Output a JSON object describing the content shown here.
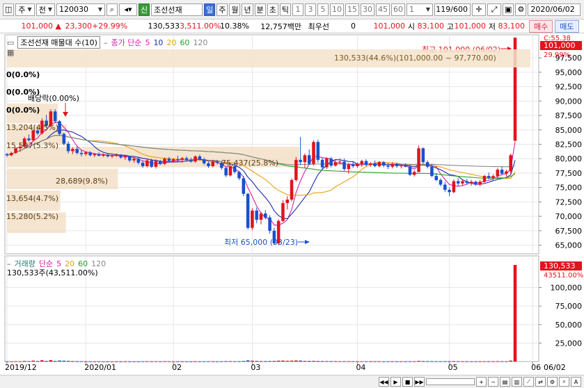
{
  "toolbar": {
    "type_label": "주",
    "period_label": "전",
    "code": "120030",
    "stock_name": "조선선재",
    "new_badge": "신",
    "periods": [
      "일",
      "주",
      "월",
      "년",
      "분",
      "초",
      "틱"
    ],
    "active_period": "일",
    "minute_steps": [
      "1",
      "3",
      "5",
      "10",
      "15",
      "30",
      "45",
      "60"
    ],
    "count_value": "1",
    "page_info": "119/600",
    "date_value": "2020/06/02"
  },
  "quote": {
    "price": "101,000",
    "change": "23,300",
    "change_pct": "+29.99%",
    "volume": "130,533",
    "volume_pct": "3,511.00%",
    "turnover": "10.38%",
    "amount": "12,757백만",
    "priority_label": "최우선",
    "priority_qty": "0",
    "priority_price": "101,000",
    "open_label": "시",
    "open": "83,100",
    "high_label": "고",
    "high": "101,000",
    "low_label": "저",
    "low": "83,100",
    "buy_label": "매수",
    "sell_label": "매도"
  },
  "price_panel": {
    "legend_name": "조선선재 매물대 수(10)",
    "ma_label": "종가 단순",
    "ma_periods": [
      "5",
      "10",
      "20",
      "60",
      "120"
    ],
    "ma_colors": [
      "#d61ea8",
      "#1a2aa8",
      "#e8a010",
      "#28a028",
      "#888888"
    ],
    "current_tag": "101,000",
    "pct_tag": "29.99%",
    "top_tag": "C:55.38",
    "high_note": "최고 101,000 (06/02)",
    "low_note": "최저 65,000 (03/23)",
    "dividend_note": "배당락(0.00%)",
    "range_note": "130,533(44.6%)(101,000.00 ~ 97,770.00)",
    "vp_labels": [
      "0(0.0%)",
      "0(0.0%)",
      "0(0.0%)",
      "13,204(4.5%)",
      "15,597(5.3%)",
      "75,437(25.8%)",
      "28,689(9.8%)",
      "13,654(4.7%)",
      "15,280(5.2%)"
    ],
    "y_ticks": [
      "97,500",
      "95,000",
      "92,500",
      "90,000",
      "87,500",
      "85,000",
      "82,500",
      "80,000",
      "77,500",
      "75,000",
      "72,500",
      "70,000",
      "67,500",
      "65,000"
    ]
  },
  "volume_panel": {
    "legend_name": "거래량",
    "ma_label": "단순",
    "ma_periods": [
      "5",
      "20",
      "60",
      "120"
    ],
    "value_note": "130,533주(43,511.00%)",
    "current_tag": "130,533",
    "pct_tag": "43511.00%",
    "y_ticks": [
      "100,000",
      "75,000",
      "50,000",
      "25,000"
    ]
  },
  "x_axis": {
    "labels": [
      "2019/12",
      "2020/01",
      "02",
      "03",
      "04",
      "05",
      "06"
    ],
    "right_label": "06/02"
  },
  "chart_data": {
    "type": "candlestick",
    "dates": [
      "2019/12",
      "2020/01",
      "02",
      "03",
      "04",
      "05",
      "06"
    ],
    "ylim": [
      63500,
      101500
    ],
    "volume_ylim": [
      0,
      130533
    ],
    "candles": [
      [
        80800,
        81000,
        80300,
        80600
      ],
      [
        80600,
        81200,
        80400,
        81000
      ],
      [
        81000,
        82000,
        80800,
        81800
      ],
      [
        81800,
        82500,
        81200,
        82100
      ],
      [
        82100,
        83800,
        81900,
        83500
      ],
      [
        83500,
        84200,
        83000,
        83200
      ],
      [
        83200,
        85100,
        83000,
        84900
      ],
      [
        84900,
        85600,
        84100,
        84400
      ],
      [
        84400,
        87000,
        84200,
        86600
      ],
      [
        86600,
        87600,
        85400,
        85700
      ],
      [
        85700,
        88600,
        85500,
        88200
      ],
      [
        88200,
        88600,
        86200,
        86500
      ],
      [
        86500,
        86700,
        84000,
        84300
      ],
      [
        84300,
        84500,
        82300,
        82600
      ],
      [
        82600,
        83000,
        80900,
        81300
      ],
      [
        81300,
        82000,
        80800,
        81700
      ],
      [
        81700,
        82200,
        80700,
        81000
      ],
      [
        81000,
        81500,
        80400,
        80800
      ],
      [
        80800,
        81300,
        80500,
        81100
      ],
      [
        81100,
        81300,
        80400,
        80600
      ],
      [
        80600,
        81000,
        80300,
        80800
      ],
      [
        80800,
        81100,
        80400,
        80500
      ],
      [
        80500,
        80900,
        80300,
        80700
      ],
      [
        80700,
        80800,
        80200,
        80400
      ],
      [
        80400,
        80700,
        80100,
        80500
      ],
      [
        80500,
        80900,
        80300,
        80700
      ],
      [
        80700,
        80800,
        80000,
        80200
      ],
      [
        80200,
        80600,
        79800,
        80400
      ],
      [
        80400,
        80500,
        79400,
        79700
      ],
      [
        79700,
        80300,
        79300,
        80000
      ],
      [
        80000,
        80200,
        79000,
        79300
      ],
      [
        79300,
        79600,
        78400,
        78700
      ],
      [
        78700,
        79900,
        78500,
        79700
      ],
      [
        79700,
        80000,
        78400,
        78600
      ],
      [
        78600,
        79900,
        78300,
        79600
      ],
      [
        79600,
        79800,
        78900,
        79100
      ],
      [
        79100,
        80200,
        78900,
        80000
      ],
      [
        80000,
        80300,
        79300,
        79600
      ],
      [
        79600,
        80100,
        79300,
        79900
      ],
      [
        79900,
        80500,
        79400,
        79800
      ],
      [
        79800,
        80300,
        79300,
        80100
      ],
      [
        80100,
        80400,
        79500,
        79800
      ],
      [
        79800,
        80200,
        79300,
        79500
      ],
      [
        79500,
        80600,
        79300,
        80400
      ],
      [
        80400,
        80700,
        79700,
        79900
      ],
      [
        79900,
        80200,
        78900,
        79200
      ],
      [
        79200,
        79500,
        78400,
        78700
      ],
      [
        78700,
        79800,
        78500,
        79500
      ],
      [
        79500,
        79800,
        79000,
        79300
      ],
      [
        79300,
        79600,
        78100,
        78400
      ],
      [
        78400,
        78700,
        76800,
        77100
      ],
      [
        77100,
        78900,
        76900,
        78700
      ],
      [
        78700,
        79200,
        77400,
        77700
      ],
      [
        77700,
        77900,
        76300,
        76600
      ],
      [
        76600,
        77000,
        73500,
        73900
      ],
      [
        73900,
        74100,
        67700,
        68000
      ],
      [
        68000,
        71400,
        67600,
        71000
      ],
      [
        71000,
        71500,
        68800,
        69400
      ],
      [
        69400,
        70800,
        68600,
        70500
      ],
      [
        70500,
        71100,
        69500,
        69800
      ],
      [
        69800,
        70200,
        67000,
        67500
      ],
      [
        67500,
        68000,
        65000,
        65300
      ],
      [
        65300,
        69500,
        65000,
        69200
      ],
      [
        69200,
        72800,
        69000,
        72300
      ],
      [
        72300,
        73500,
        71200,
        72900
      ],
      [
        72900,
        76600,
        72600,
        76300
      ],
      [
        76300,
        80300,
        76000,
        79800
      ],
      [
        79800,
        83800,
        78900,
        79400
      ],
      [
        79400,
        80900,
        78400,
        80600
      ],
      [
        80600,
        81600,
        78900,
        79100
      ],
      [
        79100,
        83200,
        78800,
        82900
      ],
      [
        82900,
        83300,
        79300,
        79800
      ],
      [
        79800,
        80100,
        78000,
        78500
      ],
      [
        78500,
        80300,
        78200,
        80000
      ],
      [
        80000,
        80300,
        78500,
        78800
      ],
      [
        78800,
        79800,
        78600,
        79400
      ],
      [
        79400,
        80100,
        79100,
        79500
      ],
      [
        79500,
        80000,
        77900,
        78200
      ],
      [
        78200,
        79300,
        77400,
        79000
      ],
      [
        79000,
        79600,
        78400,
        78700
      ],
      [
        78700,
        79300,
        78400,
        79100
      ],
      [
        79100,
        79800,
        78600,
        79600
      ],
      [
        79600,
        79900,
        78700,
        78900
      ],
      [
        78900,
        79400,
        78600,
        79200
      ],
      [
        79200,
        79700,
        78500,
        78700
      ],
      [
        78700,
        79600,
        78500,
        79400
      ],
      [
        79400,
        79600,
        78500,
        78800
      ],
      [
        78800,
        79200,
        78200,
        78600
      ],
      [
        78600,
        79400,
        78300,
        79100
      ],
      [
        79100,
        79300,
        78400,
        78700
      ],
      [
        78700,
        79100,
        78300,
        78800
      ],
      [
        78800,
        79200,
        78500,
        78600
      ],
      [
        78600,
        79000,
        77000,
        77200
      ],
      [
        77200,
        78000,
        76900,
        77700
      ],
      [
        77700,
        82300,
        77600,
        81800
      ],
      [
        81800,
        82000,
        79100,
        79400
      ],
      [
        79400,
        79700,
        78300,
        78600
      ],
      [
        78600,
        79100,
        76800,
        77000
      ],
      [
        77000,
        77500,
        76100,
        76300
      ],
      [
        76300,
        76600,
        75200,
        75500
      ],
      [
        75500,
        76000,
        74200,
        74600
      ],
      [
        74600,
        75000,
        73500,
        74200
      ],
      [
        74200,
        76400,
        74000,
        76100
      ],
      [
        76100,
        76600,
        75300,
        75700
      ],
      [
        75700,
        76400,
        75400,
        76100
      ],
      [
        76100,
        76500,
        75500,
        75800
      ],
      [
        75800,
        76300,
        75300,
        76000
      ],
      [
        76000,
        76200,
        75300,
        75500
      ],
      [
        75500,
        76300,
        75200,
        76000
      ],
      [
        76000,
        77200,
        75800,
        77000
      ],
      [
        77000,
        77600,
        76400,
        76700
      ],
      [
        76700,
        77300,
        76400,
        77000
      ],
      [
        77000,
        78400,
        76700,
        78100
      ],
      [
        78100,
        78600,
        77100,
        77400
      ],
      [
        77400,
        78100,
        76900,
        77800
      ],
      [
        77800,
        80900,
        77400,
        80600
      ],
      [
        83100,
        101000,
        83100,
        101000
      ]
    ],
    "volumes": [
      350,
      400,
      500,
      420,
      1000,
      600,
      1300,
      700,
      1800,
      900,
      2000,
      900,
      1400,
      1200,
      1000,
      700,
      600,
      500,
      400,
      350,
      300,
      300,
      280,
      260,
      250,
      280,
      260,
      300,
      350,
      280,
      320,
      400,
      450,
      420,
      480,
      400,
      500,
      420,
      360,
      340,
      330,
      300,
      320,
      380,
      360,
      420,
      460,
      400,
      360,
      420,
      620,
      560,
      480,
      540,
      880,
      1600,
      1200,
      900,
      750,
      680,
      820,
      950,
      1250,
      1350,
      1100,
      1250,
      1500,
      1350,
      950,
      850,
      1000,
      800,
      700,
      680,
      600,
      560,
      500,
      560,
      520,
      480,
      450,
      470,
      440,
      420,
      420,
      440,
      400,
      380,
      400,
      380,
      360,
      350,
      420,
      480,
      1000,
      700,
      560,
      580,
      520,
      500,
      560,
      520,
      620,
      480,
      450,
      420,
      400,
      380,
      380,
      480,
      440,
      420,
      600,
      480,
      460,
      1300,
      130533
    ]
  }
}
